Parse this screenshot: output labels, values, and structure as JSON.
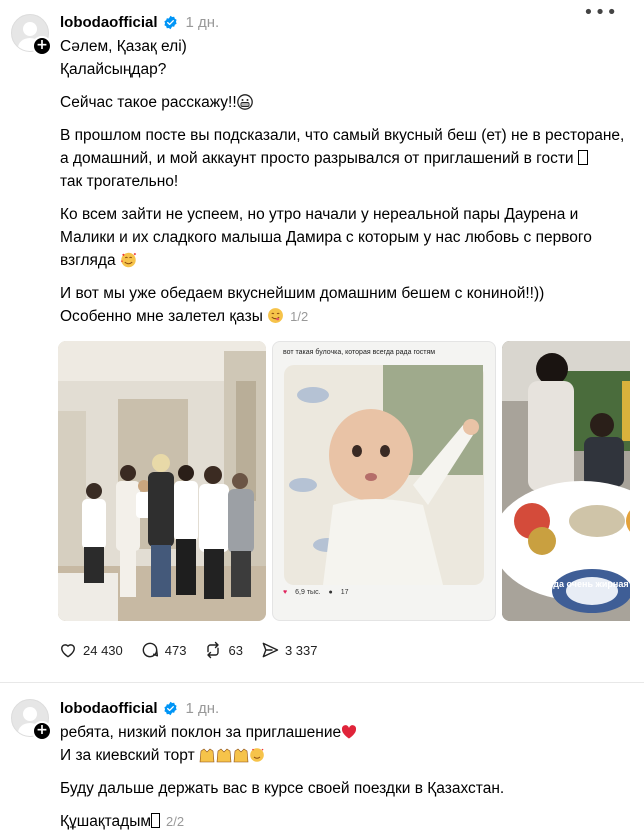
{
  "post1": {
    "username": "lobodaofficial",
    "time": "1 дн.",
    "more_icon": "ellipsis-icon",
    "lines": [
      "Сәлем, Қазақ елі)",
      "Қалайсыңдар?",
      "",
      "Сейчас такое расскажу!!",
      "",
      "В прошлом посте вы подсказали, что самый вкусный беш (ет) не в ресторане,",
      "а домашний, и мой аккаунт просто разрывался от приглашений в гости",
      "так трогательно!",
      "",
      "Ко всем зайти не успеем, но утро начали у нереальной пары Даурена и",
      "Малики и их сладкого малыша Дамира с которым у нас любовь с первого",
      "взгляда",
      "",
      "И вот мы уже обедаем вкуснейшим домашним бешем с кониной!!))",
      "Особенно мне залетел қазы"
    ],
    "pager": "1/2",
    "media": {
      "photo1_alt": "group-photo",
      "photo2_caption": "вот такая булочка, которая всегда рада гостям",
      "photo2_likes": "6,9 тыс.",
      "photo2_comments": "17",
      "photo3_caption": "когда очень жирная"
    },
    "actions": {
      "likes": "24 430",
      "comments": "473",
      "reposts": "63",
      "shares": "3 337"
    }
  },
  "post2": {
    "username": "lobodaofficial",
    "time": "1 дн.",
    "lines": [
      "ребята, низкий поклон за приглашение",
      "И за киевский торт",
      "",
      "Буду дальше держать вас в курсе своей поездки в Қазахстан.",
      "",
      "Құшақтадым"
    ],
    "pager": "2/2"
  },
  "colors": {
    "verified": "#0095f6",
    "muted": "#999999",
    "heart": "#e0245e"
  }
}
